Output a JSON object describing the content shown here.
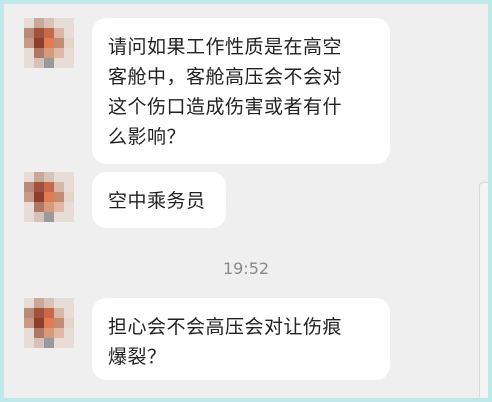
{
  "messages": [
    {
      "text": "请问如果工作性质是在高空\n客舱中，客舱高压会不会对\n这个伤口造成伤害或者有什\n么影响？"
    },
    {
      "text": "空中乘务员"
    },
    {
      "text": "担心会不会高压会对让伤痕\n爆裂？"
    }
  ],
  "timestamp": "19:52",
  "colors": {
    "outer_border": "#bfe8ea",
    "chat_background": "#efefef",
    "bubble": "#ffffff",
    "text": "#222222",
    "timestamp": "#8a8a8a"
  },
  "avatar_icon": "pixelated-avatar-icon"
}
